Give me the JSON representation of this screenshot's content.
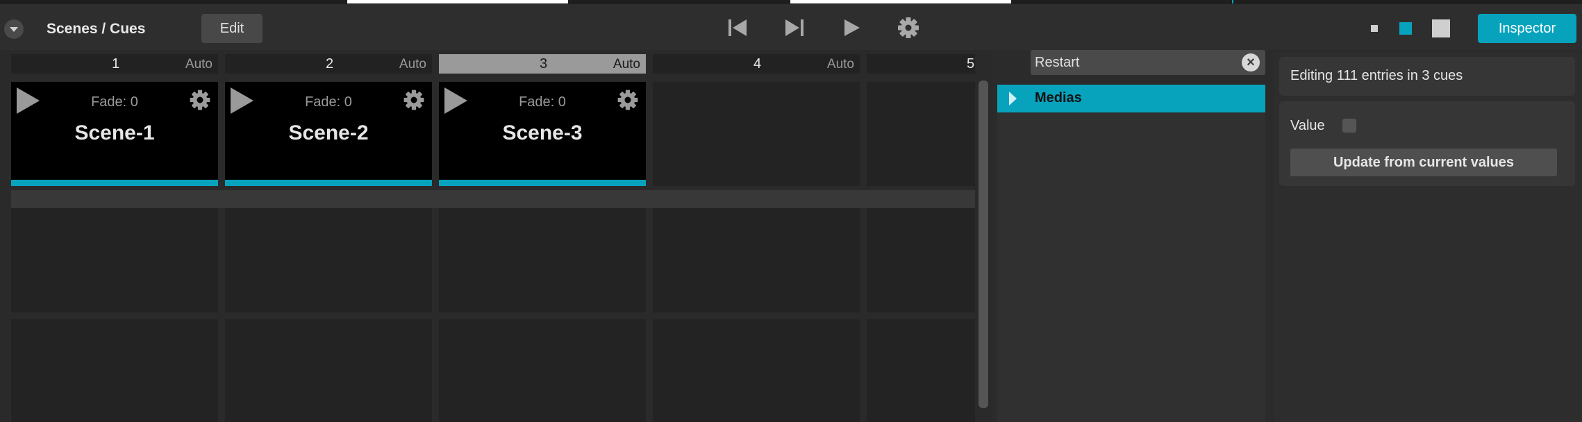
{
  "header": {
    "title": "Scenes / Cues",
    "edit_label": "Edit",
    "inspector_label": "Inspector",
    "transport_icons": [
      "skip-to-start-icon",
      "next-cue-icon",
      "play-icon",
      "settings-gear-icon"
    ],
    "view_icons": [
      "small-square-icon",
      "medium-square-icon",
      "large-square-icon"
    ]
  },
  "columns": [
    {
      "number": "1",
      "mode": "Auto"
    },
    {
      "number": "2",
      "mode": "Auto"
    },
    {
      "number": "3",
      "mode": "Auto"
    },
    {
      "number": "4",
      "mode": "Auto"
    },
    {
      "number": "5",
      "mode": ""
    }
  ],
  "cues": [
    {
      "name": "Scene-1",
      "fade": "Fade: 0"
    },
    {
      "name": "Scene-2",
      "fade": "Fade: 0"
    },
    {
      "name": "Scene-3",
      "fade": "Fade: 0"
    }
  ],
  "filter": {
    "search_value": "Restart",
    "items": [
      {
        "label": "Medias"
      }
    ]
  },
  "inspector": {
    "summary": "Editing 111 entries in 3 cues",
    "value_label": "Value",
    "update_label": "Update from current values"
  },
  "colors": {
    "accent": "#07a3bd",
    "background": "#2b2b2b",
    "cue_background": "#000000"
  }
}
